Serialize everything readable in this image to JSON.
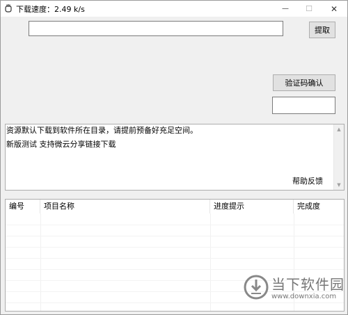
{
  "window": {
    "title": "下载速度：2.49 k/s",
    "controls": {
      "minimize": "—",
      "maximize": "☐",
      "close": "✕"
    }
  },
  "toolbar": {
    "url_value": "",
    "extract_label": "提取"
  },
  "captcha": {
    "confirm_label": "验证码确认",
    "code_value": ""
  },
  "log": {
    "lines": [
      "资源默认下载到软件所在目录，请提前预备好充足空间。",
      "新版测试 支持微云分享链接下载"
    ],
    "help_link": "帮助反馈"
  },
  "table": {
    "headers": [
      "编号",
      "项目名称",
      "进度提示",
      "完成度"
    ],
    "rows": []
  },
  "watermark": {
    "text": "当下软件园",
    "url": "www.downxia.com"
  },
  "icons": {
    "app": "hand-app-icon",
    "scroll_up": "scroll-up-arrow-icon",
    "scroll_down": "scroll-down-arrow-icon",
    "watermark_logo": "downxia-logo-icon"
  }
}
